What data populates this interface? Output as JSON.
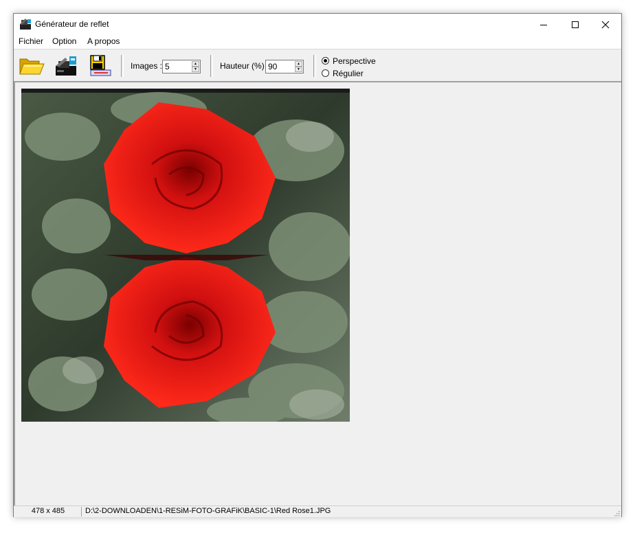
{
  "window": {
    "title": "Générateur de reflet"
  },
  "menu": [
    "Fichier",
    "Option",
    "A propos"
  ],
  "toolbar": {
    "open_icon": "folder-open-icon",
    "generate_icon": "reflection-generate-icon",
    "save_icon": "floppy-save-icon",
    "images_label": "Images :",
    "images_value": "5",
    "height_label": "Hauteur (%) :",
    "height_value": "90",
    "perspective_label": "Perspective",
    "regular_label": "Régulier",
    "selected_mode": "Perspective"
  },
  "status": {
    "dimensions": "478 x 485",
    "path": "D:\\2-DOWNLOADEN\\1-RESiM-FOTO-GRAFiK\\BASIC-1\\Red Rose1.JPG"
  }
}
